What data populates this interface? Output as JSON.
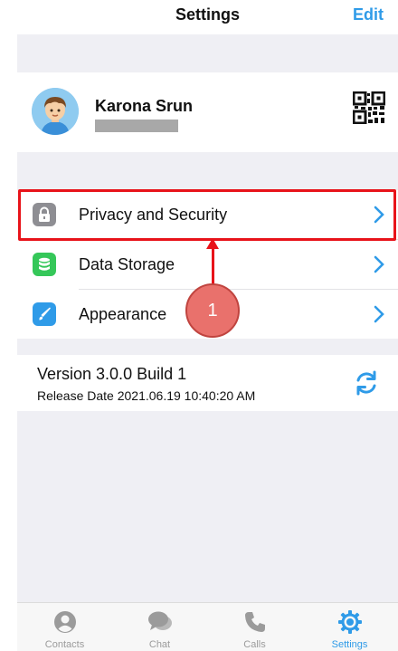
{
  "nav": {
    "title": "Settings",
    "edit_label": "Edit"
  },
  "profile": {
    "name": "Karona Srun",
    "avatar_icon": "avatar-icon",
    "qr_icon": "qr-code-icon"
  },
  "menu": {
    "items": [
      {
        "label": "Privacy and Security",
        "icon": "lock-icon",
        "color": "#8e8e93"
      },
      {
        "label": "Data Storage",
        "icon": "database-icon",
        "color": "#35c759"
      },
      {
        "label": "Appearance",
        "icon": "brush-icon",
        "color": "#2f9be8"
      }
    ]
  },
  "version": {
    "title": "Version 3.0.0 Build 1",
    "release": "Release Date 2021.06.19 10:40:20 AM",
    "icon": "refresh-icon"
  },
  "tabs": [
    {
      "label": "Contacts",
      "icon": "contacts-icon",
      "active": false
    },
    {
      "label": "Chat",
      "icon": "chat-icon",
      "active": false
    },
    {
      "label": "Calls",
      "icon": "phone-icon",
      "active": false
    },
    {
      "label": "Settings",
      "icon": "settings-icon",
      "active": true
    }
  ],
  "annotation": {
    "step": "1",
    "color": "#e8131a"
  },
  "colors": {
    "accent": "#2f9be8",
    "background": "#efeff4"
  }
}
